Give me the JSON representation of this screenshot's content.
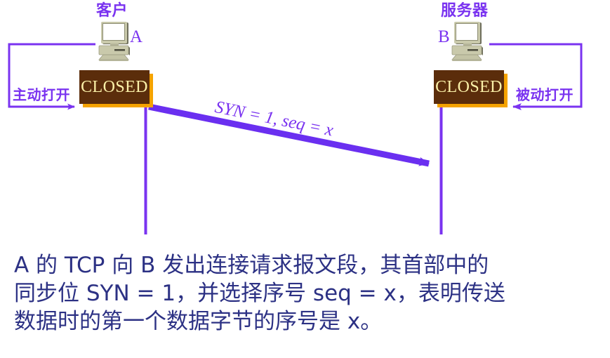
{
  "diagram": {
    "type": "tcp-three-way-handshake-step",
    "accent_purple": "#7a33f0",
    "state_box_fill": "#5b2d0b",
    "state_box_shadow": "#f5a300",
    "state_text_color": "#fbf0a8",
    "caption_color": "#2c3184"
  },
  "client": {
    "title": "客户",
    "letter": "A",
    "state": "CLOSED",
    "open_mode": "主动打开",
    "icon": "desktop-computer-icon"
  },
  "server": {
    "title": "服务器",
    "letter": "B",
    "state": "CLOSED",
    "open_mode": "被动打开",
    "icon": "desktop-computer-icon"
  },
  "message": {
    "label": "SYN = 1, seq = x",
    "direction": "client-to-server"
  },
  "caption": {
    "lines": [
      "A 的 TCP 向 B 发出连接请求报文段，其首部中的",
      "同步位 SYN = 1，并选择序号 seq = x，表明传送",
      "数据时的第一个数据字节的序号是 x。"
    ],
    "full_text": "A 的 TCP 向 B 发出连接请求报文段，其首部中的同步位 SYN = 1，并选择序号 seq = x，表明传送数据时的第一个数据字节的序号是 x。"
  }
}
